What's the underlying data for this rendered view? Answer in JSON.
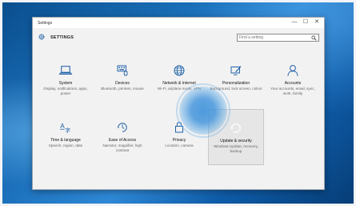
{
  "window": {
    "title": "Settings",
    "controls": {
      "minimize": "—",
      "maximize": "☐",
      "close": "✕"
    }
  },
  "header": {
    "title": "SETTINGS",
    "search_placeholder": "Find a setting"
  },
  "tiles": [
    {
      "label": "System",
      "desc": "Display, notifications, apps, power",
      "icon": "laptop-icon"
    },
    {
      "label": "Devices",
      "desc": "Bluetooth, printers, mouse",
      "icon": "keyboard-icon"
    },
    {
      "label": "Network & Internet",
      "desc": "Wi-Fi, airplane mode, VPN",
      "icon": "globe-icon"
    },
    {
      "label": "Personalization",
      "desc": "Background, lock screen, colors",
      "icon": "paint-icon"
    },
    {
      "label": "Accounts",
      "desc": "Your accounts, email, sync, work, family",
      "icon": "person-icon"
    },
    {
      "label": "Time & language",
      "desc": "Speech, region, date",
      "icon": "time-language-icon"
    },
    {
      "label": "Ease of Access",
      "desc": "Narrator, magnifier, high contrast",
      "icon": "ease-of-access-icon"
    },
    {
      "label": "Privacy",
      "desc": "Location, camera",
      "icon": "lock-icon"
    },
    {
      "label": "Update & security",
      "desc": "Windows Update, recovery, backup",
      "icon": "refresh-icon"
    }
  ],
  "colors": {
    "accent": "#0078d7",
    "icon": "#1e5fa8"
  }
}
